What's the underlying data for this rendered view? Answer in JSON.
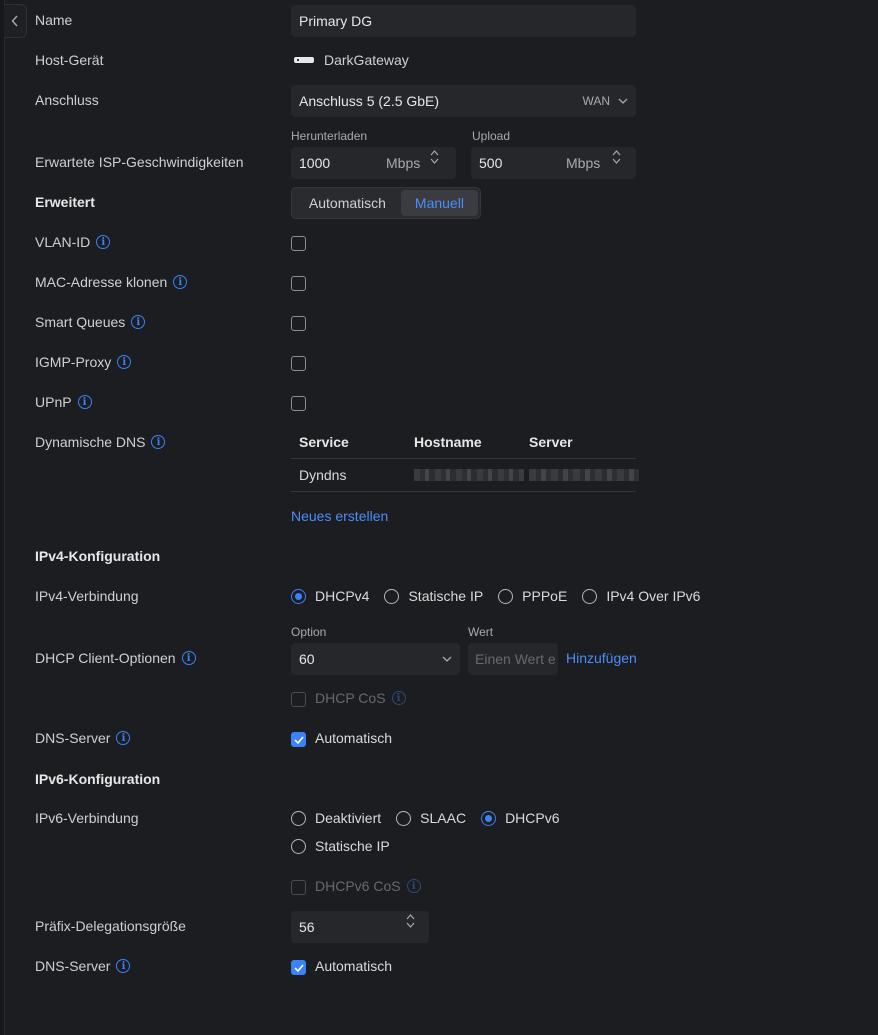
{
  "form": {
    "name": {
      "label": "Name",
      "value": "Primary DG"
    },
    "host": {
      "label": "Host-Gerät",
      "value": "DarkGateway"
    },
    "port": {
      "label": "Anschluss",
      "value": "Anschluss 5 (2.5 GbE)",
      "tag": "WAN"
    },
    "isp": {
      "label": "Erwartete ISP-Geschwindigkeiten",
      "download_label": "Herunterladen",
      "download_value": "1000",
      "download_unit": "Mbps",
      "upload_label": "Upload",
      "upload_value": "500",
      "upload_unit": "Mbps"
    },
    "advanced": {
      "label": "Erweitert",
      "options": [
        "Automatisch",
        "Manuell"
      ],
      "selected": "Manuell"
    },
    "vlan": {
      "label": "VLAN-ID"
    },
    "mac_clone": {
      "label": "MAC-Adresse klonen"
    },
    "smart_queues": {
      "label": "Smart Queues"
    },
    "igmp": {
      "label": "IGMP-Proxy"
    },
    "upnp": {
      "label": "UPnP"
    },
    "ddns": {
      "label": "Dynamische DNS",
      "columns": [
        "Service",
        "Hostname",
        "Server"
      ],
      "rows": [
        {
          "service": "Dyndns"
        }
      ],
      "create_label": "Neues erstellen"
    },
    "ipv4": {
      "section": "IPv4-Konfiguration",
      "conn_label": "IPv4-Verbindung",
      "conn_options": [
        "DHCPv4",
        "Statische IP",
        "PPPoE",
        "IPv4 Over IPv6"
      ],
      "conn_selected": "DHCPv4",
      "dhcp_label": "DHCP Client-Optionen",
      "option_label": "Option",
      "option_value": "60",
      "value_label": "Wert",
      "value_placeholder": "Einen Wert e",
      "add_label": "Hinzufügen",
      "cos_label": "DHCP CoS",
      "dns_label": "DNS-Server",
      "dns_auto": "Automatisch"
    },
    "ipv6": {
      "section": "IPv6-Konfiguration",
      "conn_label": "IPv6-Verbindung",
      "conn_options": [
        "Deaktiviert",
        "SLAAC",
        "DHCPv6",
        "Statische IP"
      ],
      "conn_selected": "DHCPv6",
      "cos_label": "DHCPv6 CoS",
      "prefix_label": "Präfix-Delegationsgröße",
      "prefix_value": "56",
      "dns_label": "DNS-Server",
      "dns_auto": "Automatisch"
    }
  },
  "colors": {
    "accent": "#3b82f6",
    "background": "#1c1d20",
    "field": "#26272b"
  }
}
